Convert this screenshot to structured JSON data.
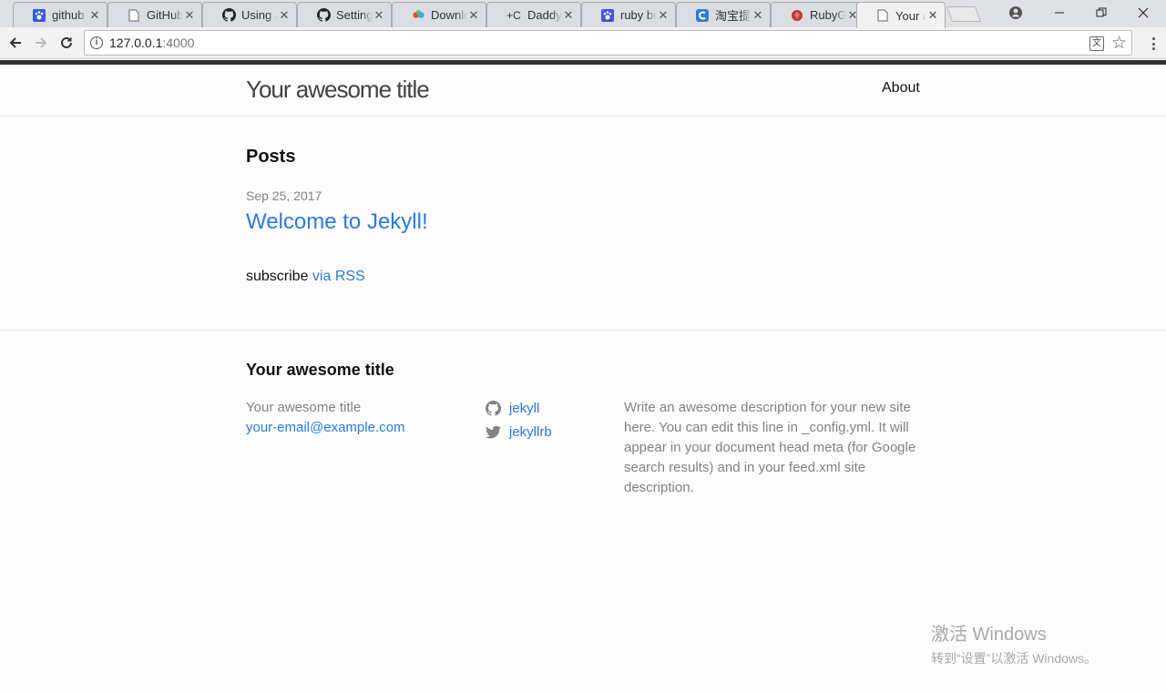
{
  "browser": {
    "tabs": [
      {
        "title": "github",
        "icon": "paw-icon"
      },
      {
        "title": "GitHub",
        "icon": "page-icon"
      },
      {
        "title": "Using J",
        "icon": "github-icon"
      },
      {
        "title": "Setting",
        "icon": "github-icon"
      },
      {
        "title": "Downlo",
        "icon": "gear-color-icon"
      },
      {
        "title": "Daddy",
        "icon": "plus-c-icon"
      },
      {
        "title": "ruby bu",
        "icon": "paw-icon"
      },
      {
        "title": "淘宝提",
        "icon": "c-icon"
      },
      {
        "title": "RubyGe",
        "icon": "ruby-icon"
      },
      {
        "title": "Your aw",
        "icon": "page-icon"
      }
    ],
    "plus_c": "+C",
    "close_glyph": "✕",
    "url_host": "127.0.0.1",
    "url_port": ":4000",
    "info_glyph": "i",
    "translate_glyph": "文",
    "star_glyph": "☆"
  },
  "site": {
    "title": "Your awesome title",
    "nav_about": "About"
  },
  "main": {
    "posts_heading": "Posts",
    "post_date": "Sep 25, 2017",
    "post_title": "Welcome to Jekyll!",
    "subscribe_text": "subscribe ",
    "subscribe_link": "via RSS"
  },
  "footer": {
    "heading": "Your awesome title",
    "name": "Your awesome title",
    "email": "your-email@example.com",
    "github_user": "jekyll",
    "twitter_user": "jekyllrb",
    "description": "Write an awesome description for your new site here. You can edit this line in _config.yml. It will appear in your document head meta (for Google search results) and in your feed.xml site description."
  },
  "watermark": {
    "line1": "激活 Windows",
    "line2": "转到“设置”以激活 Windows。"
  },
  "colors": {
    "link": "#2a7ae2",
    "muted": "#828282",
    "top_bar": "#333333"
  }
}
